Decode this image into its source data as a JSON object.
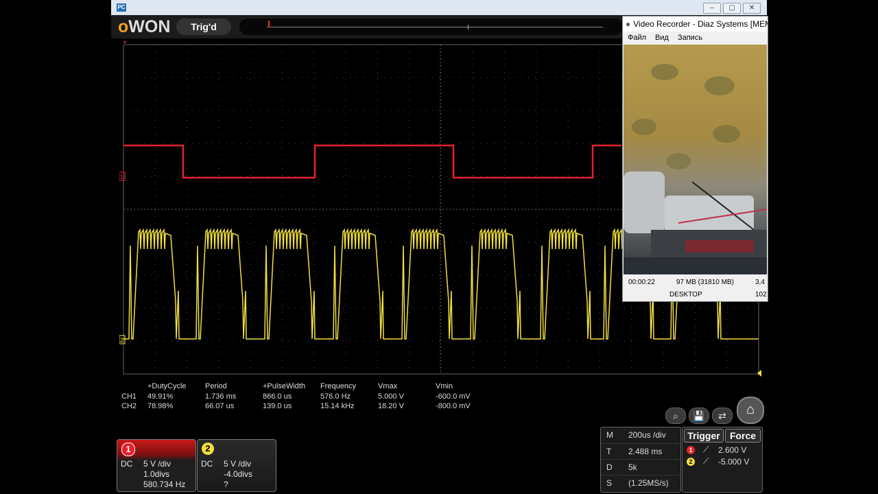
{
  "window": {
    "icon_label": "PC",
    "buttons": {
      "minimize": "–",
      "maximize": "▢",
      "close": "✕"
    }
  },
  "toolbar": {
    "logo_o": "o",
    "logo_rest": "WON",
    "trigger_status": "Trig'd"
  },
  "measurements": {
    "headers": [
      "+DutyCycle",
      "Period",
      "+PulseWidth",
      "Frequency",
      "Vmax",
      "Vmin"
    ],
    "rows": [
      {
        "channel": "CH1",
        "values": [
          "49.91%",
          "1.736 ms",
          "866.0 us",
          "576.0 Hz",
          "5.000 V",
          "-600.0 mV"
        ]
      },
      {
        "channel": "CH2",
        "values": [
          "78.98%",
          "66.07 us",
          "139.0 us",
          "15.14 kHz",
          "18.20 V",
          "-800.0 mV"
        ]
      }
    ]
  },
  "channels": [
    {
      "badge": "1",
      "coupling": "DC",
      "scale": "5 V /div",
      "offset": "1.0divs",
      "freq": "580.734 Hz",
      "color": "#e8202a"
    },
    {
      "badge": "2",
      "coupling": "DC",
      "scale": "5 V /div",
      "offset": "-4.0divs",
      "freq": "?",
      "color": "#f2e040"
    }
  ],
  "horizontal": {
    "rows": [
      {
        "key": "M",
        "value": "200us /div"
      },
      {
        "key": "T",
        "value": "2.488 ms"
      },
      {
        "key": "D",
        "value": "5k"
      },
      {
        "key": "S",
        "value": "(1.25MS/s)"
      }
    ]
  },
  "trigger": {
    "trigger_label": "Trigger",
    "force_label": "Force",
    "levels": [
      {
        "badge": "1",
        "value": "2.600 V"
      },
      {
        "badge": "2",
        "value": "-5.000 V"
      }
    ]
  },
  "markers": {
    "ch1": "1",
    "ch2": "2"
  },
  "video_recorder": {
    "title": "Video Recorder - Diaz Systems  [MEM",
    "menu": [
      "Файл",
      "Вид",
      "Запись"
    ],
    "status_time": "00:00:22",
    "status_size": "97 MB (31810 MB)",
    "status_rate": "3,4",
    "status_source": "DESKTOP",
    "status_res": "102"
  },
  "colors": {
    "ch1": "#e8202a",
    "ch2": "#f2e040",
    "grid": "#555555"
  }
}
